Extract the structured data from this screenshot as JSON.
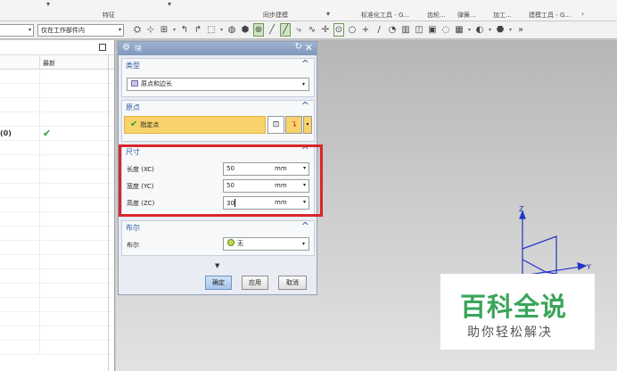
{
  "ribbon": {
    "groups": [
      "特征",
      "同步建模",
      "标准化工具 - G...",
      "齿轮...",
      "弹簧...",
      "加工...",
      "建模工具 - G..."
    ]
  },
  "toolbar": {
    "filter_value": "仅在工作部件内"
  },
  "navigator": {
    "column_latest": "最新",
    "row_label": "(0)"
  },
  "dialog": {
    "title": "块",
    "type_group": {
      "title": "类型",
      "value": "原点和边长"
    },
    "origin_group": {
      "title": "原点",
      "specify_point": "指定点"
    },
    "size_group": {
      "title": "尺寸",
      "rows": [
        {
          "label": "长度 (XC)",
          "value": "50",
          "unit": "mm"
        },
        {
          "label": "宽度 (YC)",
          "value": "50",
          "unit": "mm"
        },
        {
          "label": "高度 (ZC)",
          "value": "30",
          "unit": "mm"
        }
      ]
    },
    "boolean_group": {
      "title": "布尔",
      "label": "布尔",
      "value": "无"
    },
    "ok_label": "确定",
    "apply_label": "应用",
    "cancel_label": "取消"
  },
  "triad": {
    "z": "Z",
    "y": "Y"
  },
  "watermark": {
    "title": "百科全说",
    "subtitle": "助你轻松解决"
  },
  "colors": {
    "highlight_red": "#d9262b",
    "watermark_green": "#3aa55a",
    "point_yellow": "#f8d26a"
  }
}
